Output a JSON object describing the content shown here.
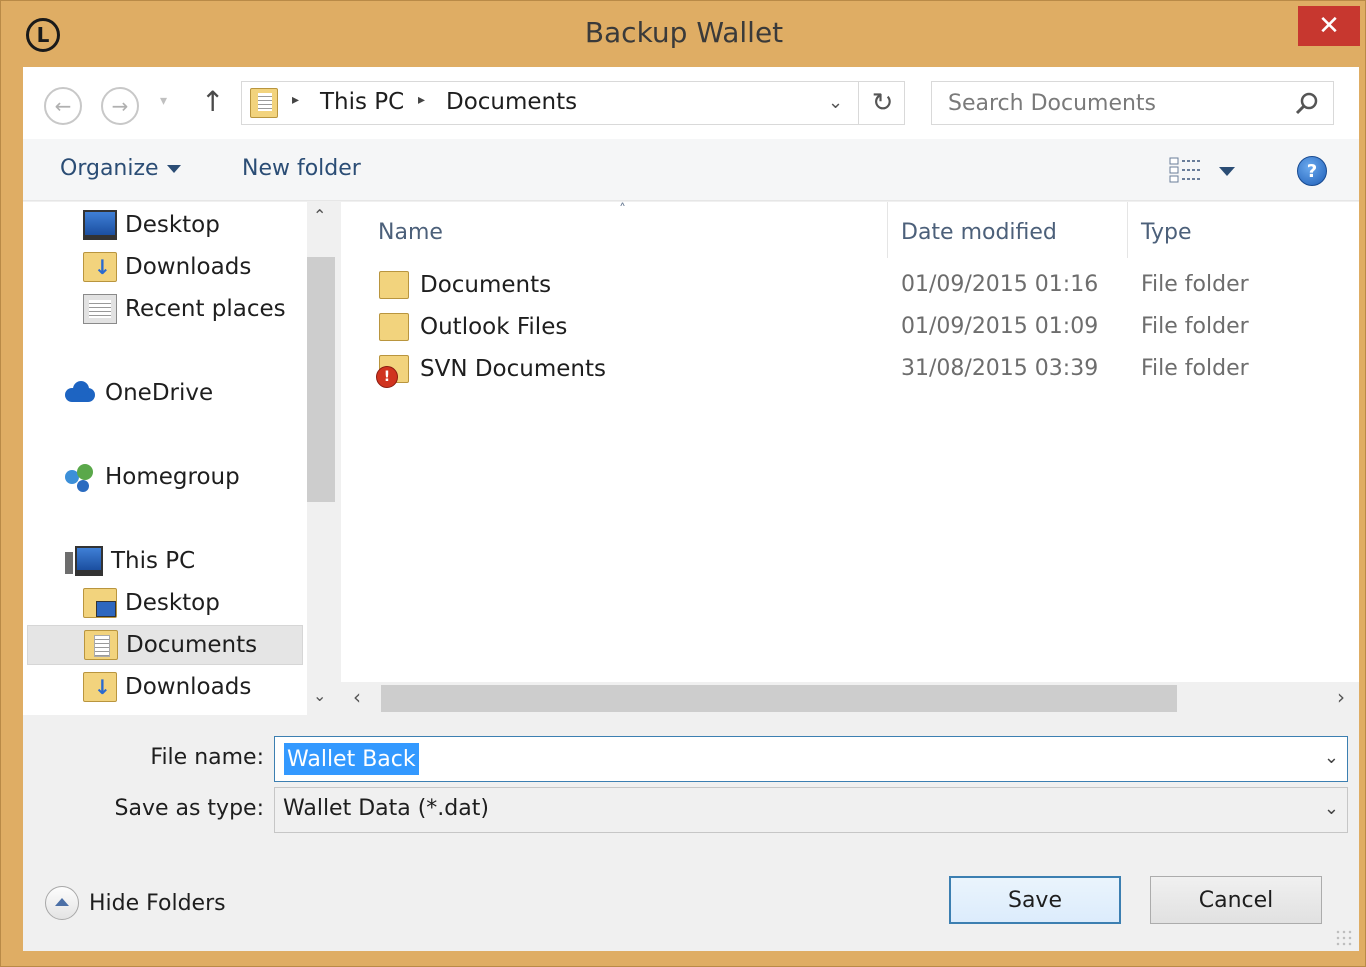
{
  "window": {
    "title": "Backup Wallet",
    "app_icon_letter": "L",
    "close_label": "✕",
    "frame_color": "#dfad64",
    "close_color": "#c7372f"
  },
  "nav": {
    "back_icon": "←",
    "forward_icon": "→",
    "recent_icon": "▾",
    "up_icon": "↑",
    "breadcrumb": [
      "This PC",
      "Documents"
    ],
    "breadcrumb_sep": "▸",
    "dropdown_icon": "⌄",
    "refresh_icon": "↻",
    "search_placeholder": "Search Documents"
  },
  "toolbar": {
    "organize_label": "Organize",
    "new_folder_label": "New folder",
    "help_label": "?"
  },
  "sidebar": {
    "items": [
      {
        "label": "Desktop",
        "icon": "desktop-icon"
      },
      {
        "label": "Downloads",
        "icon": "downloads-folder-icon"
      },
      {
        "label": "Recent places",
        "icon": "recent-places-icon"
      },
      {
        "label": "OneDrive",
        "icon": "onedrive-icon"
      },
      {
        "label": "Homegroup",
        "icon": "homegroup-icon"
      },
      {
        "label": "This PC",
        "icon": "computer-icon"
      },
      {
        "label": "Desktop",
        "icon": "desktop-folder-icon"
      },
      {
        "label": "Documents",
        "icon": "documents-folder-icon",
        "selected": true
      },
      {
        "label": "Downloads",
        "icon": "downloads-folder-icon"
      }
    ],
    "scroll_up": "⌃",
    "scroll_down": "⌄"
  },
  "filelist": {
    "columns": {
      "name": "Name",
      "date": "Date modified",
      "type": "Type"
    },
    "sort_indicator": "˄",
    "rows": [
      {
        "name": "Documents",
        "date": "01/09/2015 01:16",
        "type": "File folder"
      },
      {
        "name": "Outlook Files",
        "date": "01/09/2015 01:09",
        "type": "File folder"
      },
      {
        "name": "SVN Documents",
        "date": "31/08/2015 03:39",
        "type": "File folder"
      }
    ],
    "scroll_left": "‹",
    "scroll_right": "›"
  },
  "form": {
    "file_name_label": "File name:",
    "file_name_value": "Wallet Back",
    "save_as_type_label": "Save as type:",
    "save_as_type_value": "Wallet Data (*.dat)",
    "combo_caret": "⌄"
  },
  "footer": {
    "hide_folders_label": "Hide Folders",
    "save_label": "Save",
    "cancel_label": "Cancel"
  }
}
